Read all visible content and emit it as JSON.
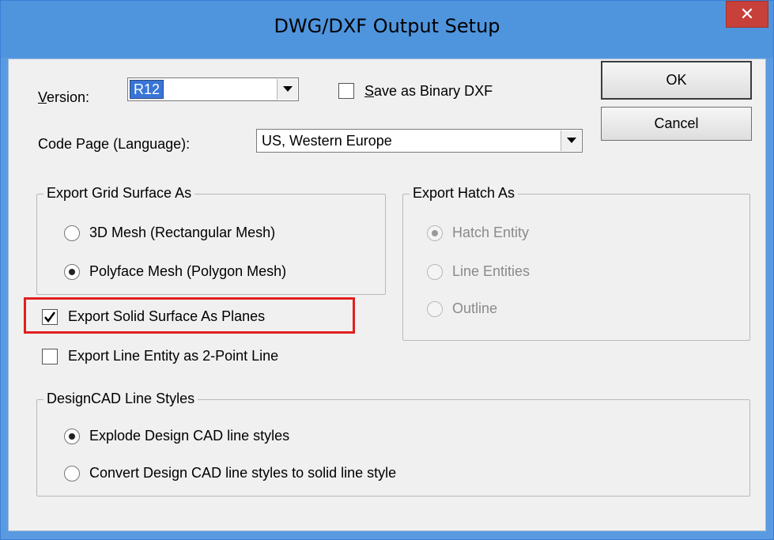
{
  "window": {
    "title": "DWG/DXF Output Setup",
    "close_glyph": "✕"
  },
  "version": {
    "label_prefix": "",
    "label_underlined": "V",
    "label_rest": "ersion:",
    "value": "R12"
  },
  "save_binary": {
    "checked": false,
    "label_underlined": "S",
    "label_rest": "ave as Binary DXF"
  },
  "code_page": {
    "label": "Code Page (Language):",
    "value": "US, Western Europe"
  },
  "buttons": {
    "ok": "OK",
    "cancel": "Cancel"
  },
  "grid_surface": {
    "title": "Export Grid Surface As",
    "options": [
      "3D Mesh (Rectangular Mesh)",
      "Polyface Mesh (Polygon Mesh)"
    ],
    "selected_index": 1
  },
  "hatch": {
    "title": "Export Hatch As",
    "options": [
      "Hatch Entity",
      "Line Entities",
      "Outline"
    ],
    "selected_index": 0,
    "disabled": true
  },
  "solid_planes": {
    "label": "Export Solid Surface As Planes",
    "checked": true,
    "highlight_color": "#e02020"
  },
  "line_entity": {
    "label": "Export Line Entity as 2-Point Line",
    "checked": false
  },
  "line_styles": {
    "title": "DesignCAD Line Styles",
    "options": [
      "Explode Design CAD line styles",
      "Convert Design CAD line styles to solid line style"
    ],
    "selected_index": 0
  },
  "colors": {
    "title_bar": "#4f95de",
    "close_button": "#c7403a",
    "selection": "#3875d7"
  }
}
